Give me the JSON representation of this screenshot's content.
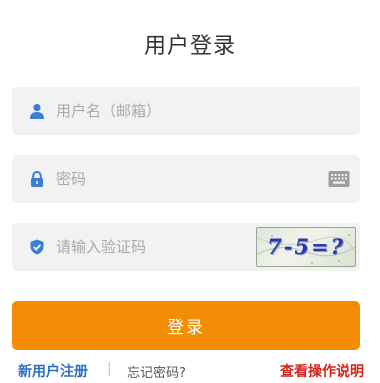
{
  "title": "用户登录",
  "username": {
    "placeholder": "用户名（邮箱）",
    "value": "",
    "icon": "user-icon"
  },
  "password": {
    "placeholder": "密码",
    "value": "",
    "icon": "lock-icon",
    "keyboard_icon": "keyboard-icon"
  },
  "captcha": {
    "placeholder": "请输入验证码",
    "value": "",
    "icon": "shield-icon",
    "image_text": "7-5=?"
  },
  "login_button": "登录",
  "links": {
    "register": "新用户注册",
    "separator": "|",
    "forgot": "忘记密码?",
    "help": "查看操作说明"
  },
  "colors": {
    "accent": "#f28d05",
    "register": "#2b6fc2",
    "help": "#d4231a",
    "icon": "#3a7fd5",
    "field_bg": "#f2f2f2"
  }
}
